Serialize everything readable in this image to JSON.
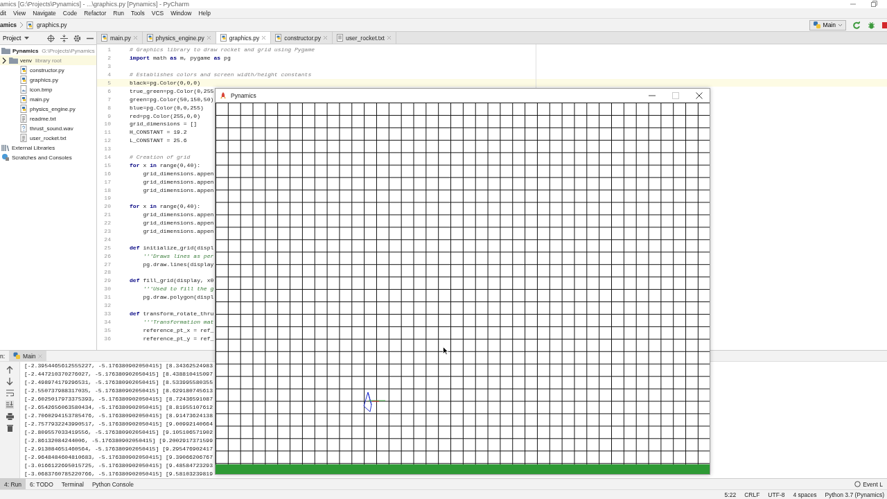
{
  "window": {
    "title": "amics [G:\\Projects\\Pynamics] - ...\\graphics.py [Pynamics] - PyCharm"
  },
  "menu": [
    "dit",
    "View",
    "Navigate",
    "Code",
    "Refactor",
    "Run",
    "Tools",
    "VCS",
    "Window",
    "Help"
  ],
  "breadcrumb": [
    "amics",
    "graphics.py"
  ],
  "run_config": {
    "label": "Main"
  },
  "project_panel": {
    "label": "Project"
  },
  "tree": [
    {
      "name": "Pynamics",
      "path": "G:\\Projects\\Pynamics",
      "kind": "project",
      "children": [
        {
          "name": "venv",
          "note": "library root",
          "kind": "library-folder",
          "expanded": false
        },
        {
          "name": "constructor.py",
          "kind": "py"
        },
        {
          "name": "graphics.py",
          "kind": "py"
        },
        {
          "name": "icon.bmp",
          "kind": "image"
        },
        {
          "name": "main.py",
          "kind": "py"
        },
        {
          "name": "physics_engine.py",
          "kind": "py"
        },
        {
          "name": "readme.txt",
          "kind": "text"
        },
        {
          "name": "thrust_sound.wav",
          "kind": "unknown"
        },
        {
          "name": "user_rocket.txt",
          "kind": "text"
        }
      ]
    },
    {
      "name": "External Libraries",
      "kind": "libraries"
    },
    {
      "name": "Scratches and Consoles",
      "kind": "scratches"
    }
  ],
  "tabs": [
    {
      "label": "main.py",
      "kind": "py",
      "selected": false
    },
    {
      "label": "physics_engine.py",
      "kind": "py",
      "selected": false
    },
    {
      "label": "graphics.py",
      "kind": "py",
      "selected": true
    },
    {
      "label": "constructor.py",
      "kind": "py",
      "selected": false
    },
    {
      "label": "user_rocket.txt",
      "kind": "text",
      "selected": false
    }
  ],
  "editor": {
    "lines": [
      {
        "no": "1",
        "kind": "comment",
        "current": false,
        "text": "# Graphics library to draw rocket and grid using Pygame"
      },
      {
        "no": "2",
        "kind": "code",
        "current": false,
        "text": "**import** math **as** m, pygame **as** pg"
      },
      {
        "no": "3",
        "current": false
      },
      {
        "no": "4",
        "kind": "comment",
        "current": false,
        "text": "# Establishes colors and screen width/height constants"
      },
      {
        "no": "5",
        "kind": "code",
        "current": true,
        "text": "black=pg.Color(0,0,0)"
      },
      {
        "no": "6",
        "kind": "code",
        "current": false,
        "text": "true_green=pg.Color(0,255"
      },
      {
        "no": "7",
        "kind": "code",
        "current": false,
        "text": "green=pg.Color(50,150,50)"
      },
      {
        "no": "8",
        "kind": "code",
        "current": false,
        "text": "blue=pg.Color(0,0,255)"
      },
      {
        "no": "9",
        "kind": "code",
        "current": false,
        "text": "red=pg.Color(255,0,0)"
      },
      {
        "no": "10",
        "kind": "code",
        "current": false,
        "text": "grid_dimensions = []"
      },
      {
        "no": "11",
        "kind": "code",
        "current": false,
        "text": "H_CONSTANT = 19.2"
      },
      {
        "no": "12",
        "kind": "code",
        "current": false,
        "text": "L_CONSTANT = 25.6"
      },
      {
        "no": "13",
        "current": false
      },
      {
        "no": "14",
        "kind": "comment",
        "current": false,
        "text": "# Creation of grid"
      },
      {
        "no": "15",
        "kind": "code",
        "current": false,
        "text": "**for** x **in** range(0,40):"
      },
      {
        "no": "16",
        "kind": "code",
        "current": false,
        "text": "    grid_dimensions.appen"
      },
      {
        "no": "17",
        "kind": "code",
        "current": false,
        "text": "    grid_dimensions.appen"
      },
      {
        "no": "18",
        "kind": "code",
        "current": false,
        "text": "    grid_dimensions.appen"
      },
      {
        "no": "19",
        "current": false
      },
      {
        "no": "20",
        "kind": "code",
        "current": false,
        "text": "**for** x **in** range(0,40):"
      },
      {
        "no": "21",
        "kind": "code",
        "current": false,
        "text": "    grid_dimensions.appen"
      },
      {
        "no": "22",
        "kind": "code",
        "current": false,
        "text": "    grid_dimensions.appen"
      },
      {
        "no": "23",
        "kind": "code",
        "current": false,
        "text": "    grid_dimensions.appen"
      },
      {
        "no": "24",
        "current": false
      },
      {
        "no": "25",
        "kind": "code",
        "current": false,
        "text": "**def** initialize_grid(displ"
      },
      {
        "no": "26",
        "kind": "docstring",
        "current": false,
        "text": "    '''Draws lines as per"
      },
      {
        "no": "27",
        "kind": "code",
        "current": false,
        "text": "    pg.draw.lines(display"
      },
      {
        "no": "28",
        "current": false
      },
      {
        "no": "29",
        "kind": "code",
        "current": false,
        "text": "**def** fill_grid(display, x0"
      },
      {
        "no": "30",
        "kind": "docstring",
        "current": false,
        "text": "    '''Used to fill the g"
      },
      {
        "no": "31",
        "kind": "code",
        "current": false,
        "text": "    pg.draw.polygon(displ"
      },
      {
        "no": "32",
        "current": false
      },
      {
        "no": "33",
        "kind": "code",
        "current": false,
        "text": "**def** transform_rotate_thru"
      },
      {
        "no": "34",
        "kind": "docstring",
        "current": false,
        "text": "    '''Transformation mat"
      },
      {
        "no": "35",
        "kind": "code",
        "current": false,
        "text": "    reference_pt_x = ref_"
      },
      {
        "no": "36",
        "kind": "code",
        "current": false,
        "text": "    reference_pt_y = ref_"
      }
    ]
  },
  "game_window": {
    "title": "Pynamics"
  },
  "run_panel": {
    "label": "n:",
    "tab": "Main",
    "output": [
      "[-2.3954465612555227, -5.176380902050415] [8.34362524983",
      "[-2.447210370276027, -5.176380902050415] [8.438810415097",
      "[-2.498974179296531, -5.176380902050415] [8.533995580355",
      "[-2.550737988317035, -5.176380902050415] [8.629180745613",
      "[-2.6025017973375393, -5.176380902050415] [8.72436591087",
      "[-2.6542656063580434, -5.176380902050415] [8.81955107612",
      "[-2.7060294153785476, -5.176380902050415] [8.91473624138",
      "[-2.7577932243990517, -5.176380902050415] [9.00992140664",
      "[-2.809557033419556, -5.176380902050415] [9.105106571902",
      "[-2.86132084244006, -5.176380902050415] [9.2002917371599",
      "[-2.913084651460564, -5.176380902050415] [9.295476902417",
      "[-2.9648484604810683, -5.176380902050415] [9.39066206767",
      "[-3.0166122695015725, -5.176380902050415] [9.48584723293",
      "[-3.0683760785220766, -5.176380902050415] [9.58103239819"
    ]
  },
  "tool_tabs": [
    {
      "label": "4: Run",
      "selected": true
    },
    {
      "label": "6: TODO",
      "selected": false
    },
    {
      "label": "Terminal",
      "selected": false
    },
    {
      "label": "Python Console",
      "selected": false
    }
  ],
  "event_log": "Event L",
  "status": [
    "5:22",
    "CRLF",
    "UTF-8",
    "4 spaces",
    "Python 3.7 (Pynamics)"
  ]
}
